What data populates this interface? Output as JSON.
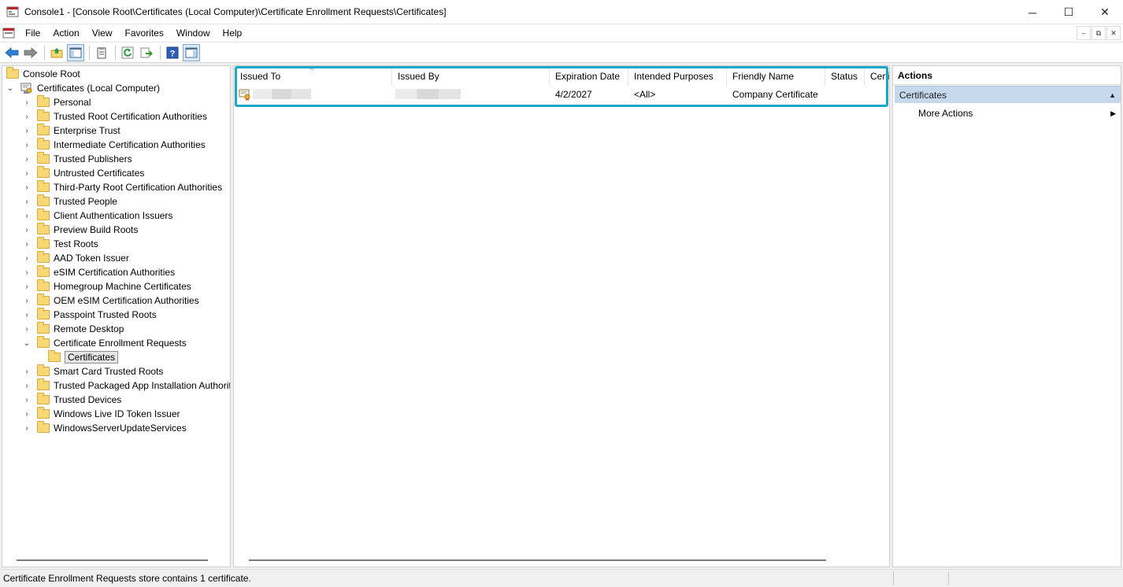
{
  "window": {
    "title": "Console1 - [Console Root\\Certificates (Local Computer)\\Certificate Enrollment Requests\\Certificates]",
    "minimize_glyph": "─",
    "maximize_glyph": "☐",
    "close_glyph": "✕"
  },
  "menu": {
    "items": [
      "File",
      "Action",
      "View",
      "Favorites",
      "Window",
      "Help"
    ],
    "mdi_min": "–",
    "mdi_restore": "⧉",
    "mdi_close": "✕"
  },
  "toolbar": {
    "icons": [
      "back-icon",
      "forward-icon",
      "up-folder-icon",
      "show-hide-tree-icon",
      "properties-icon",
      "refresh-icon",
      "export-list-icon",
      "help-icon",
      "show-hide-action-pane-icon"
    ]
  },
  "tree": {
    "root": "Console Root",
    "snapin": "Certificates (Local Computer)",
    "folders": [
      "Personal",
      "Trusted Root Certification Authorities",
      "Enterprise Trust",
      "Intermediate Certification Authorities",
      "Trusted Publishers",
      "Untrusted Certificates",
      "Third-Party Root Certification Authorities",
      "Trusted People",
      "Client Authentication Issuers",
      "Preview Build Roots",
      "Test Roots",
      "AAD Token Issuer",
      "eSIM Certification Authorities",
      "Homegroup Machine Certificates",
      "OEM eSIM Certification Authorities",
      "Passpoint Trusted Roots",
      "Remote Desktop",
      "Certificate Enrollment Requests"
    ],
    "selected_child": "Certificates",
    "folders_after": [
      "Smart Card Trusted Roots",
      "Trusted Packaged App Installation Authorit",
      "Trusted Devices",
      "Windows Live ID Token Issuer",
      "WindowsServerUpdateServices"
    ]
  },
  "list": {
    "columns": [
      "Issued To",
      "Issued By",
      "Expiration Date",
      "Intended Purposes",
      "Friendly Name",
      "Status",
      "Certi"
    ],
    "sort_glyph": "^",
    "rows": [
      {
        "issued_to": "",
        "issued_by": "",
        "expiration_date": "4/2/2027",
        "intended_purposes": "<All>",
        "friendly_name": "Company Certificate",
        "status": ""
      }
    ]
  },
  "actions": {
    "title": "Actions",
    "section": "Certificates",
    "section_glyph": "▲",
    "more_actions": "More Actions",
    "more_glyph": "▶"
  },
  "status": {
    "text": "Certificate Enrollment Requests store contains 1 certificate."
  },
  "colors": {
    "highlight": "#1aa8c8",
    "action_section_bg": "#c6d9ec",
    "folder": "#f8d775"
  }
}
